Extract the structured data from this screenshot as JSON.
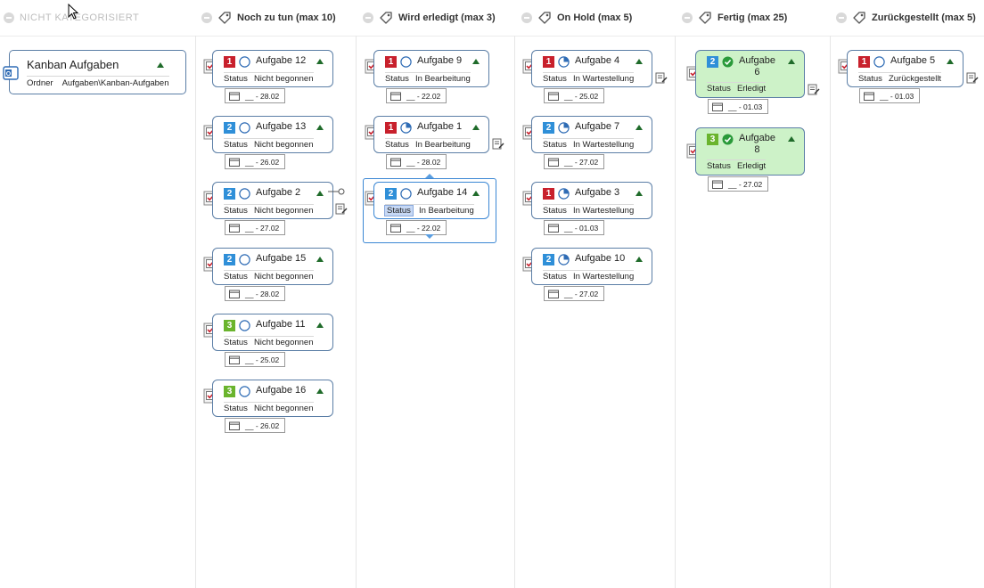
{
  "columns": [
    {
      "title": "NICHT KATEGORISIERT",
      "faded": true
    },
    {
      "title": "Noch zu tun (max 10)"
    },
    {
      "title": "Wird erledigt (max 3)"
    },
    {
      "title": "On Hold (max 5)"
    },
    {
      "title": "Fertig (max 25)"
    },
    {
      "title": "Zurückgestellt (max 5)"
    }
  ],
  "root": {
    "title": "Kanban Aufgaben",
    "field_label": "Ordner",
    "field_value": "Aufgaben\\Kanban-Aufgaben"
  },
  "status_label": "Status",
  "cards": [
    {
      "col": 1,
      "priority": "1",
      "progress": 0,
      "title": "Aufgabe 12",
      "status": "Nicht begonnen",
      "date": "__ - 28.02"
    },
    {
      "col": 1,
      "priority": "2",
      "progress": 0,
      "title": "Aufgabe 13",
      "status": "Nicht begonnen",
      "date": "__ - 26.02"
    },
    {
      "col": 1,
      "priority": "2",
      "progress": 0,
      "title": "Aufgabe 2",
      "status": "Nicht begonnen",
      "date": "__ - 27.02"
    },
    {
      "col": 1,
      "priority": "2",
      "progress": 0,
      "title": "Aufgabe 15",
      "status": "Nicht begonnen",
      "date": "__ - 28.02"
    },
    {
      "col": 1,
      "priority": "3",
      "progress": 0,
      "title": "Aufgabe 11",
      "status": "Nicht begonnen",
      "date": "__ - 25.02"
    },
    {
      "col": 1,
      "priority": "3",
      "progress": 0,
      "title": "Aufgabe 16",
      "status": "Nicht begonnen",
      "date": "__ - 26.02"
    },
    {
      "col": 2,
      "priority": "1",
      "progress": 0,
      "title": "Aufgabe 9",
      "status": "In Bearbeitung",
      "date": "__ - 22.02"
    },
    {
      "col": 2,
      "priority": "1",
      "progress": 0.25,
      "title": "Aufgabe 1",
      "status": "In Bearbeitung",
      "date": "__ - 28.02"
    },
    {
      "col": 2,
      "priority": "2",
      "progress": 0,
      "title": "Aufgabe 14",
      "status": "In Bearbeitung",
      "date": "__ - 22.02",
      "selected": true
    },
    {
      "col": 3,
      "priority": "1",
      "progress": 0.25,
      "title": "Aufgabe 4",
      "status": "In Wartestellung",
      "date": "__ - 25.02"
    },
    {
      "col": 3,
      "priority": "2",
      "progress": 0.25,
      "title": "Aufgabe 7",
      "status": "In Wartestellung",
      "date": "__ - 27.02"
    },
    {
      "col": 3,
      "priority": "1",
      "progress": 0.25,
      "title": "Aufgabe 3",
      "status": "In Wartestellung",
      "date": "__ - 01.03"
    },
    {
      "col": 3,
      "priority": "2",
      "progress": 0.25,
      "title": "Aufgabe 10",
      "status": "In Wartestellung",
      "date": "__ - 27.02"
    },
    {
      "col": 4,
      "priority": "2",
      "progress": 1,
      "title": "Aufgabe 6",
      "status": "Erledigt",
      "date": "__ - 01.03",
      "done": true
    },
    {
      "col": 4,
      "priority": "3",
      "progress": 1,
      "title": "Aufgabe 8",
      "status": "Erledigt",
      "date": "__ - 27.02",
      "done": true
    },
    {
      "col": 5,
      "priority": "1",
      "progress": 0,
      "title": "Aufgabe 5",
      "status": "Zurückgestellt",
      "date": "__ - 01.03"
    }
  ],
  "colors": {
    "priority_1": "#c8202c",
    "priority_2": "#2f8fd8",
    "priority_3": "#6ab42d",
    "done_bg": "#cdf2c8",
    "card_border": "#5b7ea6"
  }
}
